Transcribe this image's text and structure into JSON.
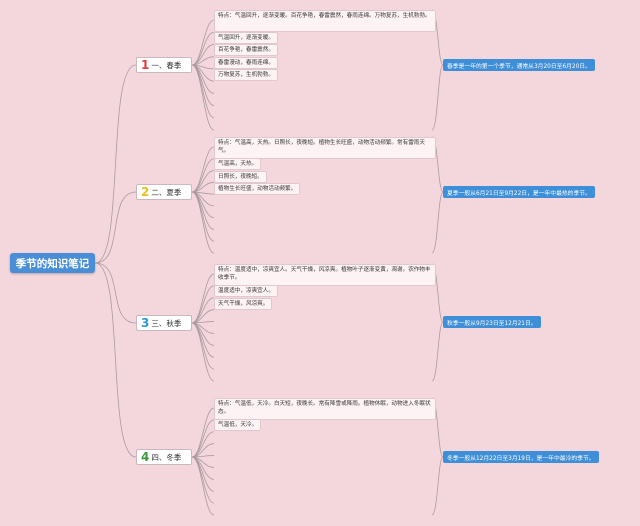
{
  "root": {
    "label": "季节的知识笔记"
  },
  "colors": {
    "spring": "#e23a3a",
    "summer": "#e8c020",
    "autumn": "#2a9ad8",
    "winter": "#3a9a3a",
    "summary_bg": "#3f8fd8",
    "line": "#a89aa0"
  },
  "seasons": [
    {
      "num": "1",
      "label": "一、春季",
      "leaves": [
        "特点：气温回升，逐渐变暖。百花争艳，春雷震然，春雨连绵。万物复苏，生机勃勃。",
        "气温回升，逐渐变暖。",
        "百花争艳，春雷震然。",
        "春雷漫动，春雨连绵。",
        "万物复苏，生机勃勃。"
      ],
      "summary": "春季是一年的第一个季节，通常从3月20日至6月20日。"
    },
    {
      "num": "2",
      "label": "二、夏季",
      "leaves": [
        "特点：气温高，天热。日照长，夜晚短。植物生长旺盛，动物活动频繁。常有雷雨天气。",
        "气温高，天热。",
        "日照长，夜晚短。",
        "植物生长旺盛，动物活动频繁。"
      ],
      "summary": "夏季一般从6月21日至9月22日，是一年中最热的季节。"
    },
    {
      "num": "3",
      "label": "三、秋季",
      "leaves": [
        "特点：温度适中，凉爽宜人。天气干燥，风凉爽。植物叶子逐渐变黄，凋谢。农作物丰收季节。",
        "温度适中，凉爽宜人。",
        "天气干燥，风凉爽。"
      ],
      "summary": "秋季一般从9月23日至12月21日。"
    },
    {
      "num": "4",
      "label": "四、冬季",
      "leaves": [
        "特点：气温低，天冷。白天短，夜晚长。常有降雪或降雨。植物休眠，动物进入冬眠状态。",
        "气温低，天冷。"
      ],
      "summary": "冬季一般从12月22日至3月19日，是一年中最冷的季节。"
    }
  ]
}
